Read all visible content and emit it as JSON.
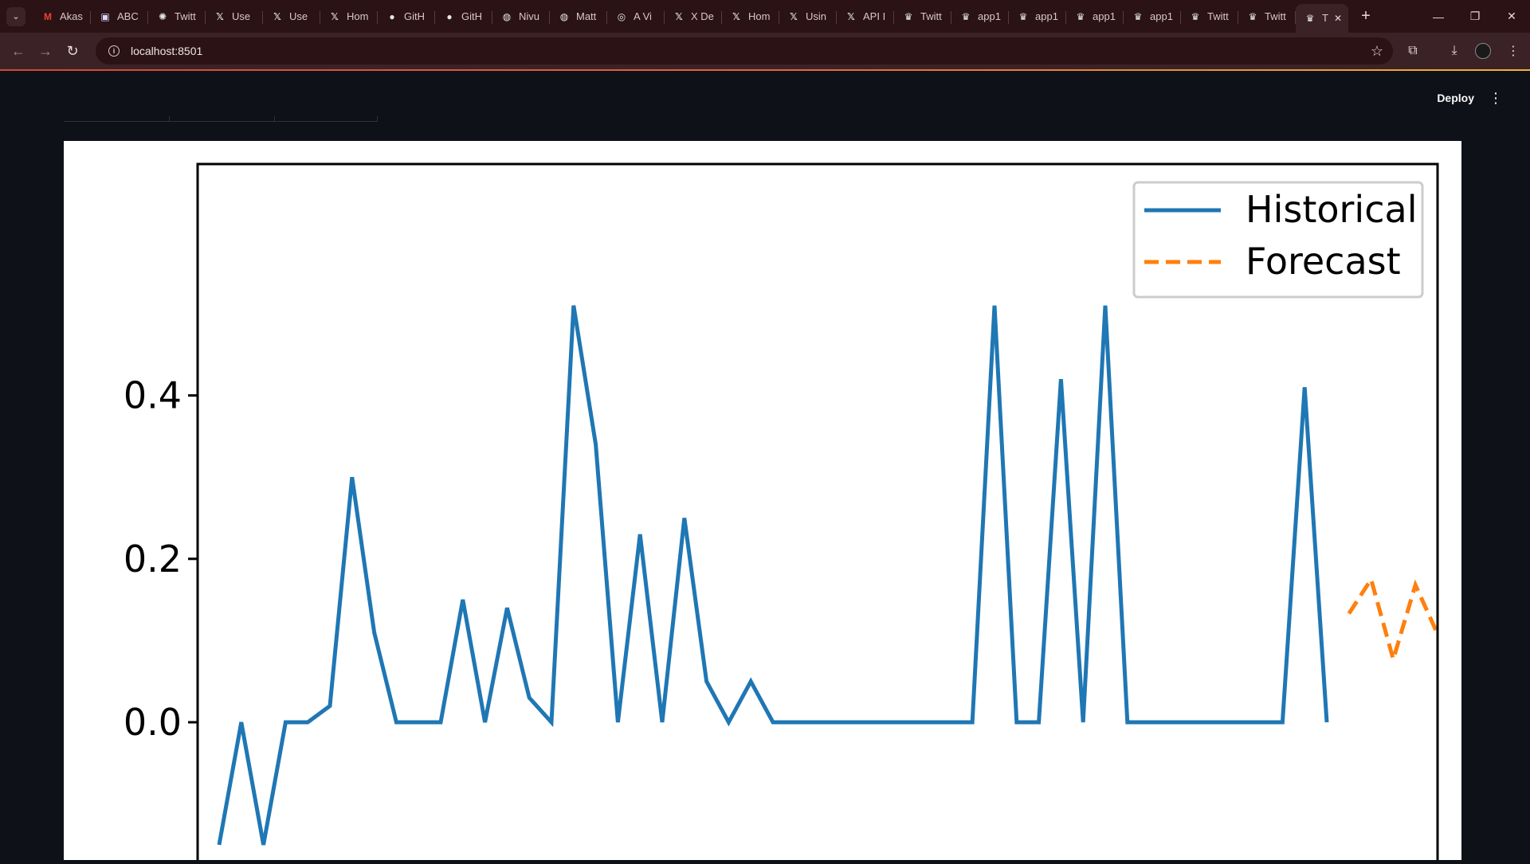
{
  "browser": {
    "tabs": [
      {
        "icon": "gmail-icon",
        "title": "Akas"
      },
      {
        "icon": "abc-icon",
        "title": "ABC"
      },
      {
        "icon": "openai-icon",
        "title": "Twitt"
      },
      {
        "icon": "x-icon",
        "title": "Use"
      },
      {
        "icon": "x-icon",
        "title": "Use"
      },
      {
        "icon": "x-icon",
        "title": "Hom"
      },
      {
        "icon": "github-icon",
        "title": "GitH"
      },
      {
        "icon": "github-icon",
        "title": "GitH"
      },
      {
        "icon": "generic-icon",
        "title": "Nivu"
      },
      {
        "icon": "generic-icon",
        "title": "Matt"
      },
      {
        "icon": "globe-icon",
        "title": "A Vi"
      },
      {
        "icon": "x-icon",
        "title": "X De"
      },
      {
        "icon": "x-icon",
        "title": "Hom"
      },
      {
        "icon": "x-icon",
        "title": "Usin"
      },
      {
        "icon": "x-icon",
        "title": "API I"
      },
      {
        "icon": "streamlit-icon",
        "title": "Twitt"
      },
      {
        "icon": "streamlit-icon",
        "title": "app1"
      },
      {
        "icon": "streamlit-icon",
        "title": "app1"
      },
      {
        "icon": "streamlit-icon",
        "title": "app1"
      },
      {
        "icon": "streamlit-icon",
        "title": "app1"
      },
      {
        "icon": "streamlit-icon",
        "title": "Twitt"
      },
      {
        "icon": "streamlit-icon",
        "title": "Twitt"
      }
    ],
    "active_tab": {
      "icon": "streamlit-icon",
      "title": "T"
    },
    "url": "localhost:8501",
    "colors": {
      "frame": "#2a1215",
      "toolbar": "#3b2226",
      "accent": "#e0653c"
    }
  },
  "app": {
    "deploy_label": "Deploy",
    "menu_icon": "more-vertical-icon",
    "background": "#0e1117"
  },
  "chart_data": {
    "type": "line",
    "title": "",
    "xlabel": "",
    "ylabel": "",
    "ylim": [
      -0.145,
      0.545
    ],
    "yticks": [
      0.0,
      0.2,
      0.4
    ],
    "ytick_labels": [
      "0.0",
      "0.2",
      "0.4"
    ],
    "legend_position": "top-right",
    "grid": false,
    "series": [
      {
        "name": "Historical",
        "style": "solid",
        "color": "#1f77b4",
        "x": [
          0,
          1,
          2,
          3,
          4,
          5,
          6,
          7,
          8,
          9,
          10,
          11,
          12,
          13,
          14,
          15,
          16,
          17,
          18,
          19,
          20,
          21,
          22,
          23,
          24,
          25,
          26,
          27,
          28,
          29,
          30,
          31,
          32,
          33,
          34,
          35,
          36,
          37,
          38,
          39,
          40,
          41,
          42,
          43,
          44,
          45,
          46,
          47,
          48,
          49,
          50
        ],
        "values": [
          -0.15,
          0.0,
          -0.15,
          0.0,
          0.0,
          0.02,
          0.3,
          0.11,
          0.0,
          0.0,
          0.0,
          0.15,
          0.0,
          0.14,
          0.03,
          0.0,
          0.51,
          0.34,
          0.0,
          0.23,
          0.0,
          0.25,
          0.05,
          0.0,
          0.05,
          0.0,
          0.0,
          0.0,
          0.0,
          0.0,
          0.0,
          0.0,
          0.0,
          0.0,
          0.0,
          0.51,
          0.0,
          0.0,
          0.42,
          0.0,
          0.51,
          0.0,
          0.0,
          0.0,
          0.0,
          0.0,
          0.0,
          0.0,
          0.0,
          0.41,
          0.0
        ]
      },
      {
        "name": "Forecast",
        "style": "dashed",
        "color": "#ff7f0e",
        "x": [
          51,
          52,
          53,
          54,
          55,
          56,
          57
        ],
        "values": [
          0.133,
          0.175,
          0.077,
          0.168,
          0.108,
          0.133,
          0.13
        ]
      }
    ]
  }
}
